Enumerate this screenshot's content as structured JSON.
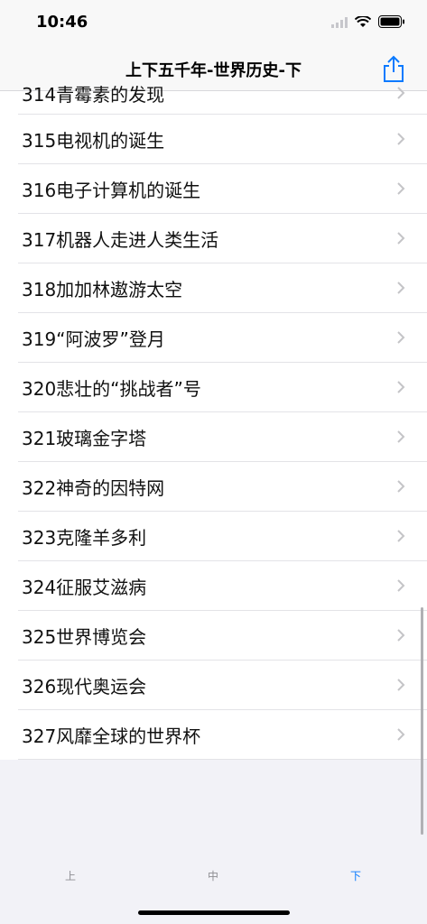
{
  "status": {
    "time": "10:46"
  },
  "nav": {
    "title": "上下五千年-世界历史-下"
  },
  "items": [
    "314青霉素的发现",
    "315电视机的诞生",
    "316电子计算机的诞生",
    "317机器人走进人类生活",
    "318加加林遨游太空",
    "319“阿波罗”登月",
    "320悲壮的“挑战者”号",
    "321玻璃金字塔",
    "322神奇的因特网",
    "323克隆羊多利",
    "324征服艾滋病",
    "325世界博览会",
    "326现代奥运会",
    "327风靡全球的世界杯"
  ],
  "tabs": {
    "first": "上",
    "second": "中",
    "third": "下"
  },
  "colors": {
    "accent": "#0a7aff",
    "chevron": "#c4c4c7"
  },
  "icons": {
    "share": "share-icon",
    "chevron": "chevron-right-icon",
    "wifi": "wifi-icon",
    "battery": "battery-icon"
  }
}
